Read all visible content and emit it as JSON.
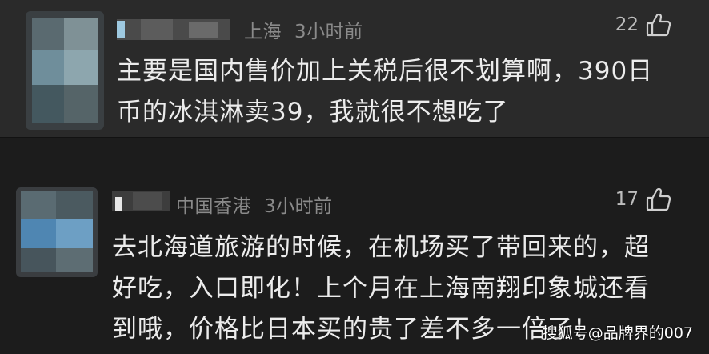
{
  "comments": [
    {
      "location": "上海",
      "time": "3小时前",
      "likes": "22",
      "lines": [
        "主要是国内售价加上关税后很不划算啊，390日",
        "币的冰淇淋卖39，我就很不想吃了"
      ]
    },
    {
      "location": "中国香港",
      "time": "3小时前",
      "likes": "17",
      "lines": [
        "去北海道旅游的时候，在机场买了带回来的，超",
        "好吃，入口即化！上个月在上海南翔印象城还看",
        "到哦，价格比日本买的贵了差不多一倍了！"
      ]
    }
  ],
  "watermark": "搜狐号@品牌界的007",
  "icons": {
    "like": "thumbs-up-icon"
  },
  "colors": {
    "background_top": "#2a2a2a",
    "background_bottom": "#1c1c1c",
    "text": "#ececec",
    "meta": "#8a8a8a"
  }
}
